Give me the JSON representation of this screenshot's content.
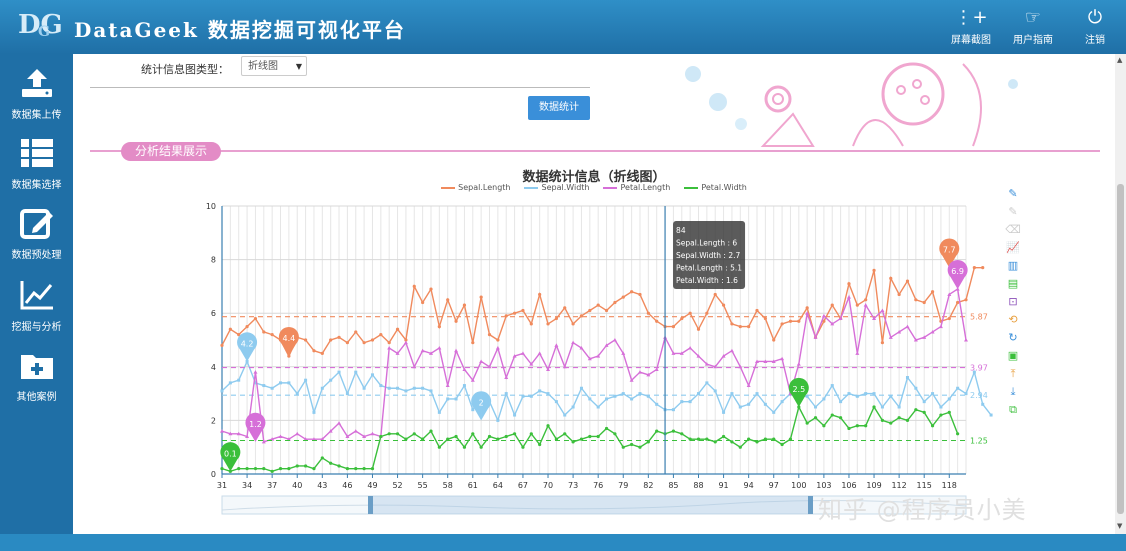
{
  "app": {
    "logo": "DG",
    "logo_sub": "G",
    "title": "DataGeek 数据挖掘可视化平台"
  },
  "top_actions": [
    {
      "label": "屏幕截图",
      "icon": "screenshot-icon",
      "glyph": "⋮+"
    },
    {
      "label": "用户指南",
      "icon": "guide-icon",
      "glyph": "☞"
    },
    {
      "label": "注销",
      "icon": "power-icon",
      "glyph": "⏻"
    }
  ],
  "sidebar": {
    "items": [
      {
        "label": "数据集上传",
        "icon": "upload-icon"
      },
      {
        "label": "数据集选择",
        "icon": "list-icon"
      },
      {
        "label": "数据预处理",
        "icon": "edit-icon"
      },
      {
        "label": "挖掘与分析",
        "icon": "line-chart-icon"
      },
      {
        "label": "其他案例",
        "icon": "folder-add-icon"
      }
    ]
  },
  "form": {
    "type_label": "统计信息图类型：",
    "type_value": "折线图",
    "submit_label": "数据统计"
  },
  "section": {
    "title": "分析结果展示"
  },
  "watermark": "知乎 @程序员小美",
  "colors": {
    "sepal_length": "#f08a5d",
    "sepal_width": "#8ecbef",
    "petal_length": "#d66fd8",
    "petal_width": "#3bbf3b",
    "topbar": "#2a86c0",
    "accent": "#e38cc6"
  },
  "chart_data": {
    "type": "line",
    "title": "数据统计信息（折线图）",
    "ylim": [
      0,
      10
    ],
    "yticks": [
      0,
      2,
      4,
      6,
      8,
      10
    ],
    "x_start": 31,
    "x_end": 120,
    "xticks": [
      31,
      34,
      37,
      40,
      43,
      46,
      49,
      52,
      55,
      58,
      61,
      64,
      67,
      70,
      73,
      76,
      79,
      82,
      85,
      88,
      91,
      94,
      97,
      100,
      103,
      106,
      109,
      112,
      115,
      118
    ],
    "series": [
      {
        "name": "Sepal.Length",
        "color": "#f08a5d",
        "marker": "circle",
        "values": [
          4.8,
          5.4,
          5.2,
          5.5,
          5.8,
          5.3,
          5.2,
          5.0,
          4.4,
          5.1,
          5.0,
          4.6,
          4.5,
          5.0,
          5.1,
          4.9,
          5.3,
          4.9,
          5.0,
          5.2,
          4.9,
          5.4,
          5.0,
          7.0,
          6.4,
          6.9,
          5.5,
          6.5,
          5.7,
          6.3,
          4.9,
          6.6,
          5.2,
          5.0,
          5.9,
          6.0,
          6.1,
          5.6,
          6.7,
          5.6,
          5.8,
          6.2,
          5.6,
          5.9,
          6.1,
          6.3,
          6.1,
          6.4,
          6.6,
          6.8,
          6.7,
          6.0,
          5.7,
          5.5,
          5.5,
          5.8,
          6.0,
          5.4,
          6.0,
          6.7,
          6.3,
          5.6,
          5.5,
          5.5,
          6.1,
          5.8,
          5.0,
          5.6,
          5.7,
          5.7,
          6.2,
          5.1,
          5.7,
          6.3,
          5.8,
          7.1,
          6.3,
          6.5,
          7.6,
          4.9,
          7.3,
          6.7,
          7.2,
          6.5,
          6.4,
          6.8,
          5.7,
          5.8,
          6.4,
          6.5,
          7.7,
          7.7
        ],
        "marks": [
          {
            "label": "4.4",
            "x": 39,
            "y": 4.4
          },
          {
            "label": "7.7",
            "x": 118,
            "y": 7.7
          }
        ],
        "avg": 5.87
      },
      {
        "name": "Sepal.Width",
        "color": "#8ecbef",
        "marker": "square",
        "values": [
          3.1,
          3.4,
          3.5,
          4.2,
          3.4,
          3.3,
          3.2,
          3.4,
          3.4,
          3.0,
          3.5,
          2.3,
          3.2,
          3.5,
          3.8,
          3.0,
          3.8,
          3.2,
          3.7,
          3.3,
          3.2,
          3.2,
          3.1,
          3.2,
          3.2,
          3.1,
          2.3,
          2.8,
          2.8,
          3.3,
          2.4,
          2.9,
          2.7,
          2.0,
          3.0,
          2.2,
          2.9,
          2.9,
          3.1,
          3.0,
          2.7,
          2.2,
          2.5,
          3.2,
          2.8,
          2.5,
          2.8,
          2.9,
          3.0,
          2.8,
          3.0,
          2.9,
          2.6,
          2.4,
          2.4,
          2.7,
          2.7,
          3.0,
          3.4,
          3.1,
          2.3,
          3.0,
          2.5,
          2.6,
          3.0,
          2.6,
          2.3,
          2.7,
          3.0,
          2.9,
          2.9,
          2.5,
          2.8,
          3.3,
          2.7,
          3.0,
          2.9,
          3.0,
          3.0,
          2.5,
          2.9,
          2.5,
          3.6,
          3.2,
          2.7,
          3.0,
          2.5,
          2.8,
          3.2,
          3.0,
          3.8,
          2.6,
          2.2
        ],
        "marks": [
          {
            "label": "4.2",
            "x": 34,
            "y": 4.2
          },
          {
            "label": "2",
            "x": 62,
            "y": 2.0
          }
        ],
        "avg": 2.94
      },
      {
        "name": "Petal.Length",
        "color": "#d66fd8",
        "marker": "triangle",
        "values": [
          1.6,
          1.5,
          1.5,
          1.4,
          3.8,
          1.2,
          1.3,
          1.4,
          1.3,
          1.5,
          1.3,
          1.3,
          1.3,
          1.6,
          1.9,
          1.4,
          1.6,
          1.4,
          1.5,
          1.4,
          4.7,
          4.5,
          4.9,
          4.0,
          4.6,
          4.5,
          4.7,
          3.3,
          4.6,
          3.9,
          3.5,
          4.2,
          4.0,
          4.7,
          3.6,
          4.4,
          4.5,
          4.1,
          4.5,
          3.9,
          4.8,
          4.0,
          4.9,
          4.7,
          4.3,
          4.4,
          4.8,
          5.0,
          4.5,
          3.5,
          3.8,
          3.7,
          3.9,
          5.1,
          4.5,
          4.5,
          4.7,
          4.4,
          4.1,
          4.0,
          4.4,
          4.6,
          4.0,
          3.3,
          4.2,
          4.2,
          4.2,
          4.3,
          3.0,
          4.1,
          6.0,
          5.1,
          5.9,
          5.6,
          5.8,
          6.6,
          4.5,
          6.3,
          5.8,
          6.1,
          5.1,
          5.3,
          5.5,
          5.0,
          5.1,
          5.3,
          5.5,
          6.7,
          6.9,
          5.0
        ],
        "marks": [
          {
            "label": "1.2",
            "x": 35,
            "y": 1.2
          },
          {
            "label": "6.9",
            "x": 119,
            "y": 6.9
          }
        ],
        "avg": 3.97
      },
      {
        "name": "Petal.Width",
        "color": "#3bbf3b",
        "marker": "circle",
        "values": [
          0.2,
          0.1,
          0.2,
          0.2,
          0.2,
          0.2,
          0.1,
          0.2,
          0.2,
          0.3,
          0.3,
          0.2,
          0.6,
          0.4,
          0.3,
          0.2,
          0.2,
          0.2,
          0.2,
          1.4,
          1.5,
          1.5,
          1.3,
          1.5,
          1.3,
          1.6,
          1.0,
          1.3,
          1.4,
          1.0,
          1.5,
          1.0,
          1.4,
          1.3,
          1.4,
          1.5,
          1.0,
          1.5,
          1.1,
          1.8,
          1.3,
          1.5,
          1.2,
          1.3,
          1.4,
          1.4,
          1.7,
          1.5,
          1.0,
          1.1,
          1.0,
          1.2,
          1.6,
          1.5,
          1.6,
          1.5,
          1.3,
          1.3,
          1.3,
          1.2,
          1.4,
          1.2,
          1.0,
          1.3,
          1.2,
          1.3,
          1.3,
          1.1,
          1.3,
          2.5,
          1.9,
          2.1,
          1.8,
          2.2,
          2.1,
          1.7,
          1.8,
          1.8,
          2.5,
          2.0,
          1.9,
          2.1,
          2.0,
          2.4,
          2.3,
          1.8,
          2.2,
          2.3,
          1.5
        ],
        "marks": [
          {
            "label": "0.1",
            "x": 32,
            "y": 0.1
          },
          {
            "label": "2.5",
            "x": 100,
            "y": 2.5
          }
        ],
        "avg": 1.25
      }
    ],
    "tooltip": {
      "x": 84,
      "lines": [
        "84",
        "Sepal.Length : 6",
        "Sepal.Width : 2.7",
        "Petal.Length : 5.1",
        "Petal.Width : 1.6"
      ]
    }
  }
}
